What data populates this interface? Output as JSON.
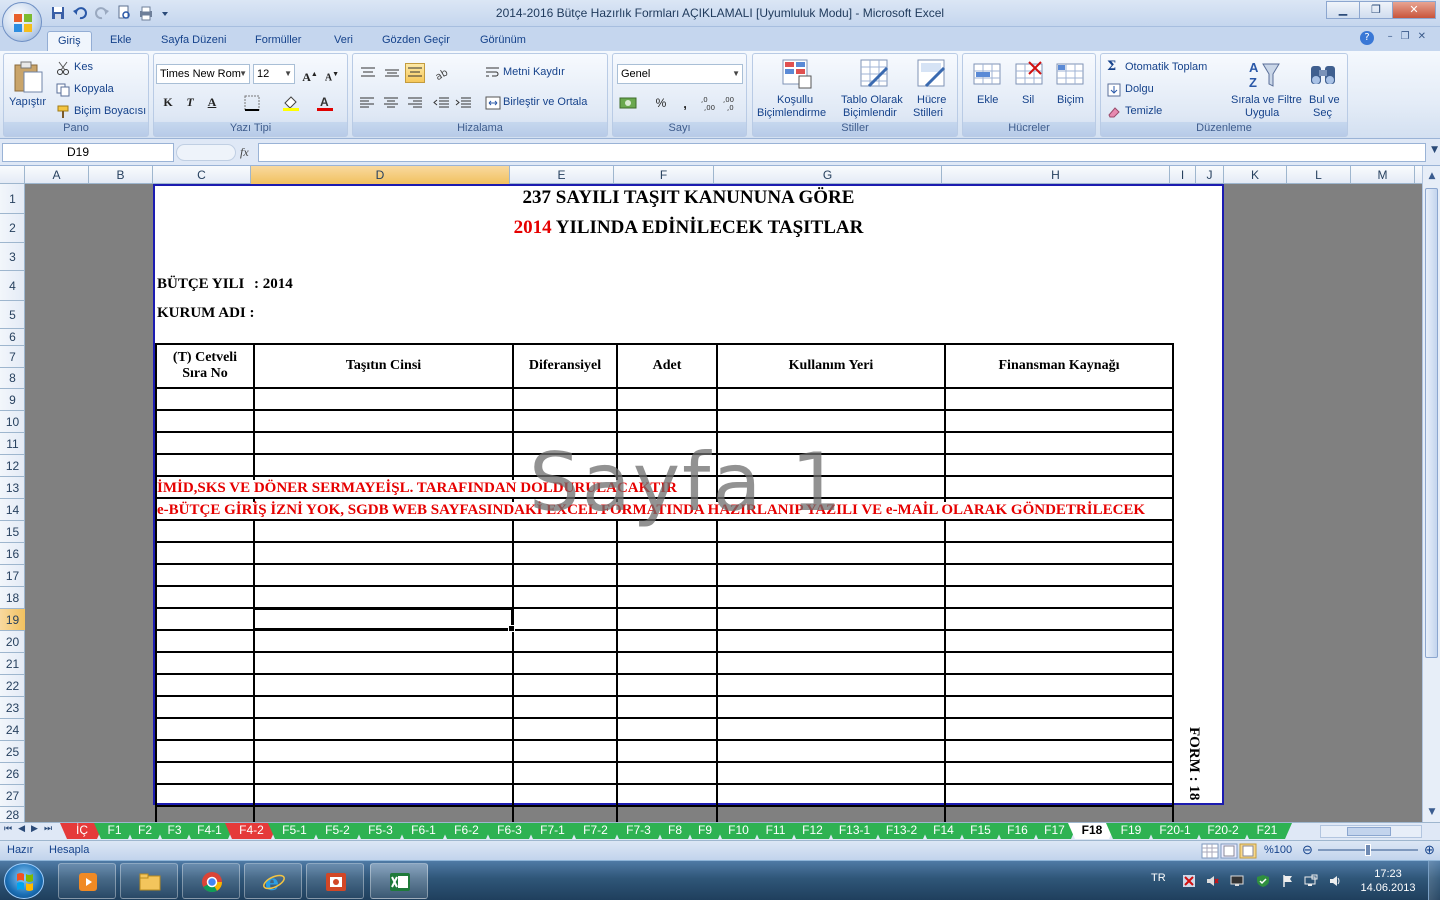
{
  "window": {
    "title": "2014-2016 Bütçe Hazırlık Formları AÇIKLAMALI  [Uyumluluk Modu] - Microsoft Excel",
    "minimize": "▁",
    "restore": "❐",
    "close": "✕"
  },
  "ribbon_tabs": [
    "Giriş",
    "Ekle",
    "Sayfa Düzeni",
    "Formüller",
    "Veri",
    "Gözden Geçir",
    "Görünüm"
  ],
  "ribbon": {
    "pano": {
      "label": "Pano",
      "paste": "Yapıştır",
      "cut": "Kes",
      "copy": "Kopyala",
      "format_painter": "Biçim Boyacısı"
    },
    "yazi_tipi": {
      "label": "Yazı Tipi",
      "font": "Times New Rom",
      "size": "12",
      "bold": "K",
      "italic": "T",
      "underline": "A"
    },
    "hizalama": {
      "label": "Hizalama",
      "wrap": "Metni Kaydır",
      "merge": "Birleştir ve Ortala"
    },
    "sayi": {
      "label": "Sayı",
      "format": "Genel",
      "percent": "%",
      "comma": "000"
    },
    "stiller": {
      "label": "Stiller",
      "conditional": [
        "Koşullu",
        "Biçimlendirme"
      ],
      "table": [
        "Tablo Olarak",
        "Biçimlendir"
      ],
      "cell_styles": [
        "Hücre",
        "Stilleri"
      ]
    },
    "hucreler": {
      "label": "Hücreler",
      "insert": "Ekle",
      "delete": "Sil",
      "format": "Biçim"
    },
    "duzenleme": {
      "label": "Düzenleme",
      "autosum": "Otomatik Toplam",
      "fill": "Dolgu",
      "clear": "Temizle",
      "sort": [
        "Sırala ve Filtre",
        "Uygula"
      ],
      "find": [
        "Bul ve",
        "Seç"
      ]
    }
  },
  "formula_bar": {
    "name_box": "D19",
    "fx": "fx",
    "value": ""
  },
  "columns": [
    "A",
    "B",
    "C",
    "D",
    "E",
    "F",
    "G",
    "H",
    "I",
    "J",
    "K",
    "L",
    "M"
  ],
  "selected_column": "D",
  "rows": [
    "1",
    "2",
    "3",
    "4",
    "5",
    "6",
    "7",
    "8",
    "9",
    "10",
    "11",
    "12",
    "13",
    "14",
    "15",
    "16",
    "17",
    "18",
    "19",
    "20",
    "21",
    "22",
    "23",
    "24",
    "25",
    "26",
    "27",
    "28"
  ],
  "selected_row": "19",
  "sheet": {
    "title1": "237 SAYILI TAŞIT KANUNUNA GÖRE",
    "title2_year": "2014",
    "title2_rest": " YILINDA EDİNİLECEK TAŞITLAR",
    "budget_year_label": "BÜTÇE YILI",
    "budget_year_value": ": 2014",
    "institution_label": "KURUM ADI :",
    "table_headers": [
      "(T) Cetveli Sıra No",
      "Taşıtın Cinsi",
      "Diferansiyel",
      "Adet",
      "Kullanım Yeri",
      "Finansman Kaynağı"
    ],
    "note1": "İMİD,SKS VE DÖNER SERMAYEİŞL. TARAFINDAN DOLDURULACAKTIR",
    "note2": "e-BÜTÇE GİRİŞ İZNİ YOK, SGDB WEB SAYFASINDAKİ EXCEL FORMATINDA HAZIRLANIP YAZILI VE e-MAİL OLARAK GÖNDETRİLECEK",
    "watermark": "Sayfa 1",
    "form_code": "FORM : 18"
  },
  "sheet_tabs": [
    {
      "label": "İÇ",
      "color": "red"
    },
    {
      "label": "F1",
      "color": "green"
    },
    {
      "label": "F2",
      "color": "green"
    },
    {
      "label": "F3",
      "color": "green"
    },
    {
      "label": "F4-1",
      "color": "green"
    },
    {
      "label": "F4-2",
      "color": "red"
    },
    {
      "label": "F5-1",
      "color": "green"
    },
    {
      "label": "F5-2",
      "color": "green"
    },
    {
      "label": "F5-3",
      "color": "green"
    },
    {
      "label": "F6-1",
      "color": "green"
    },
    {
      "label": "F6-2",
      "color": "green"
    },
    {
      "label": "F6-3",
      "color": "green"
    },
    {
      "label": "F7-1",
      "color": "green"
    },
    {
      "label": "F7-2",
      "color": "green"
    },
    {
      "label": "F7-3",
      "color": "green"
    },
    {
      "label": "F8",
      "color": "green"
    },
    {
      "label": "F9",
      "color": "green"
    },
    {
      "label": "F10",
      "color": "green"
    },
    {
      "label": "F11",
      "color": "green"
    },
    {
      "label": "F12",
      "color": "green"
    },
    {
      "label": "F13-1",
      "color": "green"
    },
    {
      "label": "F13-2",
      "color": "green"
    },
    {
      "label": "F14",
      "color": "green"
    },
    {
      "label": "F15",
      "color": "green"
    },
    {
      "label": "F16",
      "color": "green"
    },
    {
      "label": "F17",
      "color": "green"
    },
    {
      "label": "F18",
      "color": "active"
    },
    {
      "label": "F19",
      "color": "green"
    },
    {
      "label": "F20-1",
      "color": "green"
    },
    {
      "label": "F20-2",
      "color": "green"
    },
    {
      "label": "F21",
      "color": "green"
    }
  ],
  "status": {
    "ready": "Hazır",
    "calc": "Hesapla",
    "zoom": "%100"
  },
  "taskbar": {
    "lang": "TR",
    "time": "17:23",
    "date": "14.06.2013"
  }
}
